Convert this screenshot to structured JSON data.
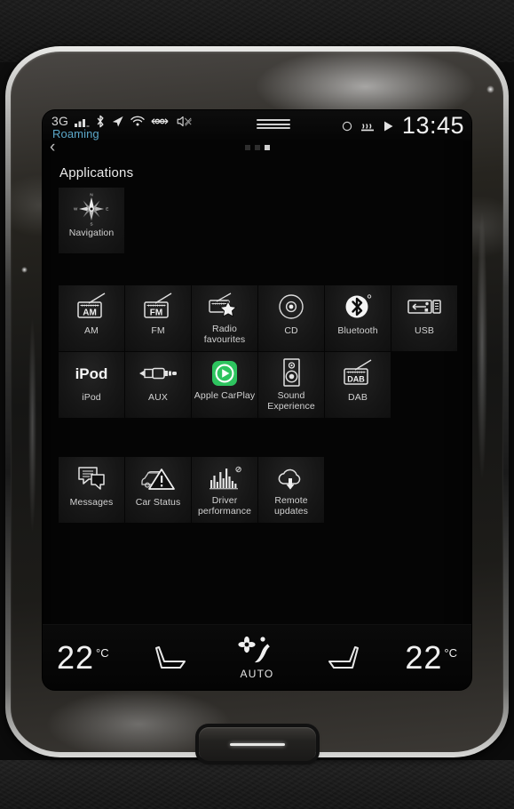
{
  "statusbar": {
    "network": "3G",
    "signal_icon": "signal-bars-icon",
    "bluetooth_icon": "bluetooth-icon",
    "location_icon": "location-arrow-icon",
    "wifi_icon": "wifi-icon",
    "usb_icon": "usb-tether-icon",
    "sound_off_icon": "sound-muted-icon",
    "roaming": "Roaming",
    "menu_icon": "hamburger-menu-icon",
    "circle_icon": "recirculation-icon",
    "heated_icon": "heated-seat-icon",
    "play_icon": "play-icon",
    "clock": "13:45"
  },
  "nav": {
    "back_icon": "back-chevron-icon",
    "pages": 3,
    "active_page": 3
  },
  "applications": {
    "title": "Applications",
    "navigation": {
      "label": "Navigation",
      "icon": "compass-rose-icon"
    }
  },
  "media_tiles": [
    {
      "label": "AM",
      "icon": "radio-am-icon"
    },
    {
      "label": "FM",
      "icon": "radio-fm-icon"
    },
    {
      "label": "Radio favourites",
      "icon": "radio-star-icon"
    },
    {
      "label": "CD",
      "icon": "cd-disc-icon"
    },
    {
      "label": "Bluetooth",
      "icon": "bluetooth-icon"
    },
    {
      "label": "USB",
      "icon": "usb-icon"
    },
    {
      "label": "iPod",
      "icon": "ipod-wordmark-icon"
    },
    {
      "label": "AUX",
      "icon": "aux-jack-icon"
    },
    {
      "label": "Apple CarPlay",
      "icon": "apple-carplay-icon"
    },
    {
      "label": "Sound Experience",
      "icon": "speaker-icon"
    },
    {
      "label": "DAB",
      "icon": "radio-dab-icon"
    }
  ],
  "app_tiles": [
    {
      "label": "Messages",
      "icon": "speech-bubbles-icon"
    },
    {
      "label": "Car Status",
      "icon": "car-warning-icon"
    },
    {
      "label": "Driver performance",
      "icon": "bar-chart-icon"
    },
    {
      "label": "Remote updates",
      "icon": "cloud-download-icon"
    }
  ],
  "climate": {
    "left_temp": "22",
    "left_unit": "°C",
    "right_temp": "22",
    "right_unit": "°C",
    "left_seat_icon": "seat-icon",
    "right_seat_icon": "seat-icon",
    "airflow_icon": "fan-airflow-icon",
    "auto_label": "AUTO"
  },
  "hardware": {
    "home_button": "home-button"
  },
  "colors": {
    "accent_blue": "#5ba7c9",
    "carplay_green": "#2ec45f",
    "text": "#e4e4e4"
  }
}
